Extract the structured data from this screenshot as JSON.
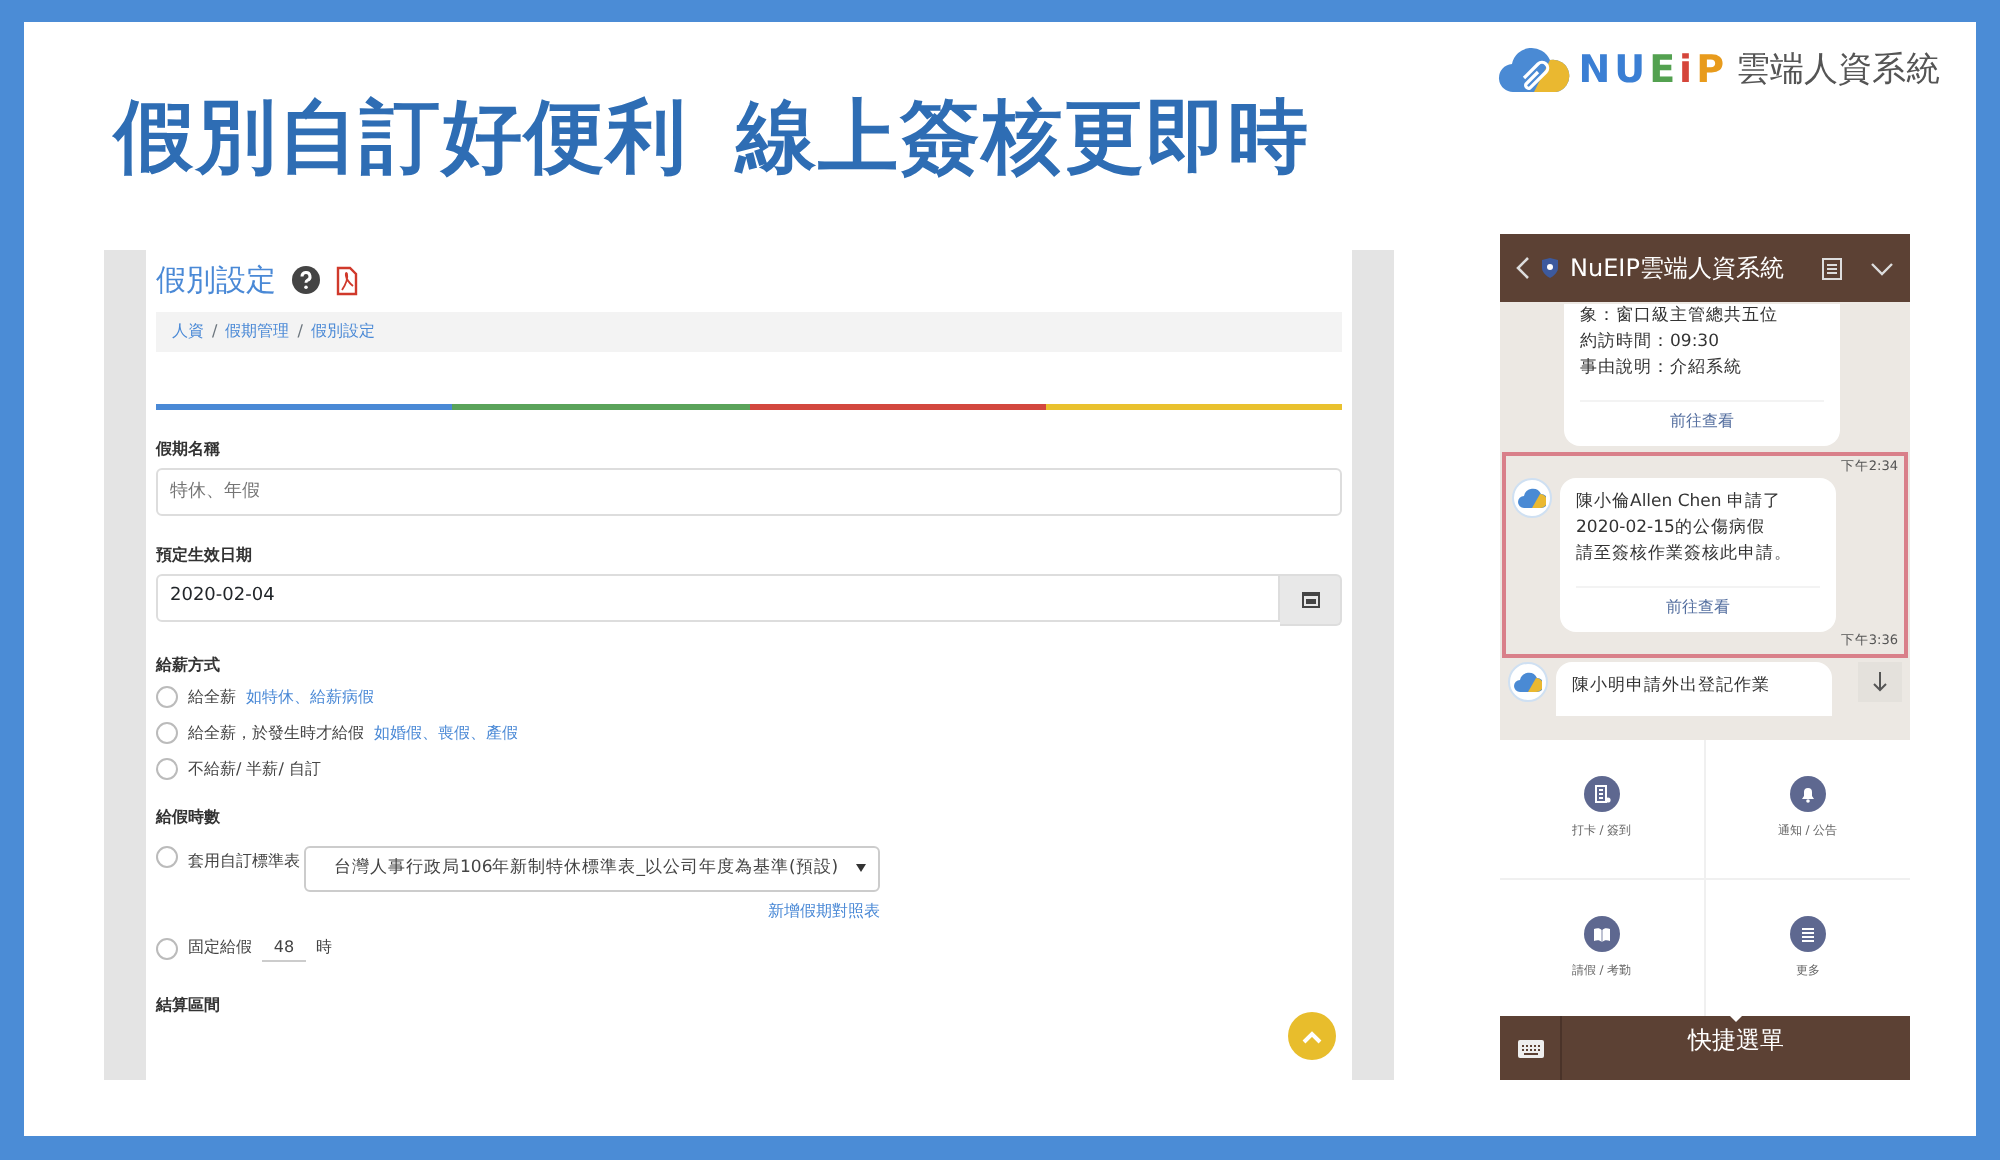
{
  "banner": {
    "headline": [
      "假別自訂好便利",
      "線上簽核更即時"
    ],
    "logo_mark": "NUEiP",
    "logo_text": "雲端人資系統"
  },
  "web": {
    "title": "假別設定",
    "breadcrumb": [
      "人資",
      "假期管理",
      "假別設定"
    ],
    "breadcrumb_separator": "/",
    "name_field": {
      "label": "假期名稱",
      "placeholder": "特休、年假"
    },
    "date_field": {
      "label": "預定生效日期",
      "value": "2020-02-04"
    },
    "pay_method": {
      "label": "給薪方式",
      "options": [
        {
          "text": "給全薪",
          "hint": "如特休、給薪病假",
          "selected": false
        },
        {
          "text": "給全薪，於發生時才給假",
          "hint": "如婚假、喪假、產假",
          "selected": false
        },
        {
          "text": "不給薪/ 半薪/ 自訂",
          "selected": false
        }
      ]
    },
    "grant_hours": {
      "label": "給假時數",
      "options": [
        {
          "kind": "select",
          "text": "套用自訂標準表",
          "value": "台灣人事行政局106年新制特休標準表_以公司年度為基準(預設)",
          "link": "新增假期對照表",
          "selected": false
        },
        {
          "kind": "number",
          "text": "固定給假",
          "value": "48",
          "unit": "時",
          "selected": false
        }
      ]
    },
    "settle_label": "結算區間"
  },
  "phone": {
    "title": "NuEIP雲端人資系統",
    "messages": [
      {
        "kind": "partial",
        "lines": [
          "象：窗口級主管總共五位",
          "約訪時間：09:30",
          "事由說明：介紹系統"
        ],
        "link": "前往查看",
        "time": "下午2:34",
        "highlighted": false
      },
      {
        "kind": "full",
        "lines": [
          "陳小倫Allen Chen 申請了",
          "2020-02-15的公傷病假",
          "請至簽核作業簽核此申請。"
        ],
        "link": "前往查看",
        "time": "下午3:36",
        "highlighted": true
      },
      {
        "kind": "cut",
        "lines": [
          "陳小明申請外出登記作業"
        ]
      }
    ],
    "menu": [
      {
        "label": "打卡 / 簽到"
      },
      {
        "label": "通知 / 公告"
      },
      {
        "label": "請假 / 考勤"
      },
      {
        "label": "更多"
      }
    ],
    "menu_title": "快捷選單"
  }
}
